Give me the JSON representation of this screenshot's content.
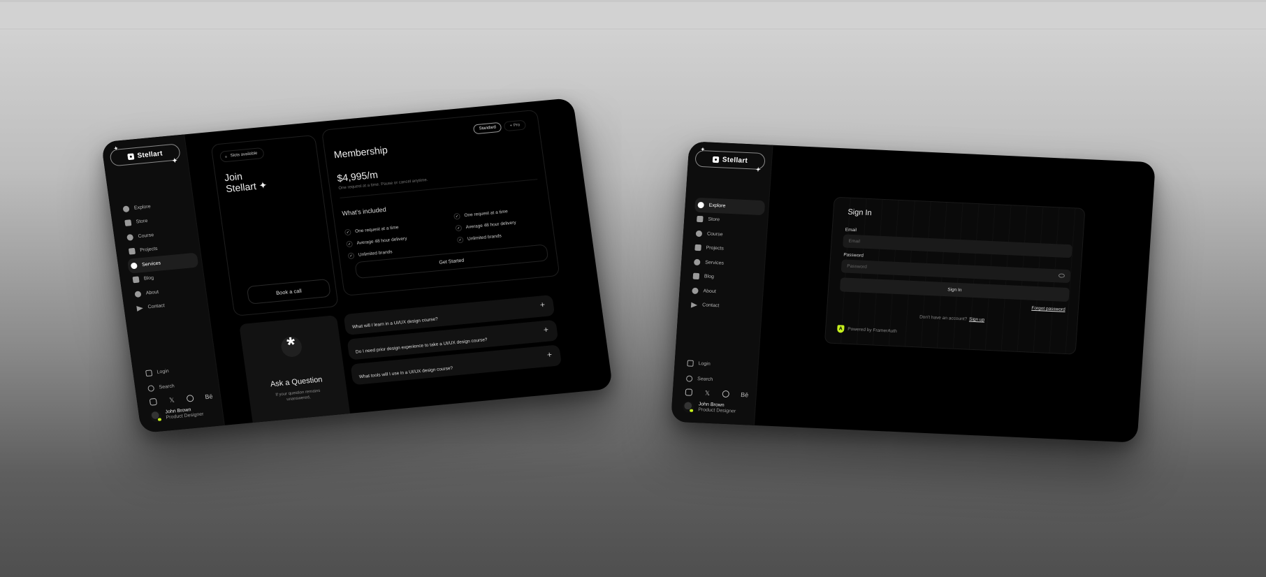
{
  "brand": {
    "name": "Stellart",
    "accent_color": "#c6f01e"
  },
  "sidebar": {
    "items": [
      {
        "label": "Explore",
        "icon": "compass-icon"
      },
      {
        "label": "Store",
        "icon": "bag-icon"
      },
      {
        "label": "Course",
        "icon": "graduation-cap-icon"
      },
      {
        "label": "Projects",
        "icon": "edit-icon"
      },
      {
        "label": "Services",
        "icon": "plus-circle-icon"
      },
      {
        "label": "Blog",
        "icon": "document-icon"
      },
      {
        "label": "About",
        "icon": "user-icon"
      },
      {
        "label": "Contact",
        "icon": "send-icon"
      }
    ],
    "bottom": {
      "login_label": "Login",
      "search_label": "Search",
      "socials": [
        "instagram",
        "x",
        "dribbble",
        "behance"
      ],
      "behance_label": "Bē",
      "x_label": "𝕏"
    },
    "user": {
      "name": "John Brown",
      "role": "Product Designer"
    }
  },
  "screen1": {
    "active_nav": "Services",
    "join_card": {
      "badge": "Slots available",
      "title_line1": "Join",
      "title_line2": "Stellart ✦",
      "cta": "Book a call"
    },
    "membership": {
      "title": "Membership",
      "plans": [
        "Standard",
        "+ Pro"
      ],
      "selected_plan": "Standard",
      "price": "$4,995/m",
      "price_note": "One request at a time. Pause or cancel anytime.",
      "included_title": "What's included",
      "features_col1": [
        "One request at a time",
        "Average 48 hour delivery",
        "Unlimited brands"
      ],
      "features_col2": [
        "One request at a time",
        "Average 48 hour delivery",
        "Unlimited brands"
      ],
      "cta": "Get Started"
    },
    "ask": {
      "title": "Ask a Question",
      "subtitle": "If your question remains unanswered,"
    },
    "faq": [
      "What will I learn in a UI/UX design course?",
      "Do I need prior design experience to take a UI/UX design course?",
      "What tools will I use in a UI/UX design course?"
    ]
  },
  "screen2": {
    "active_nav": "Explore",
    "signin": {
      "title": "Sign In",
      "email_label": "Email",
      "email_placeholder": "Email",
      "password_label": "Password",
      "password_placeholder": "Password",
      "submit": "Sign In",
      "forgot": "Forgot password",
      "no_account": "Don't have an account?",
      "signup": "Sign up",
      "powered_by": "Powered by FramerAuth"
    }
  }
}
